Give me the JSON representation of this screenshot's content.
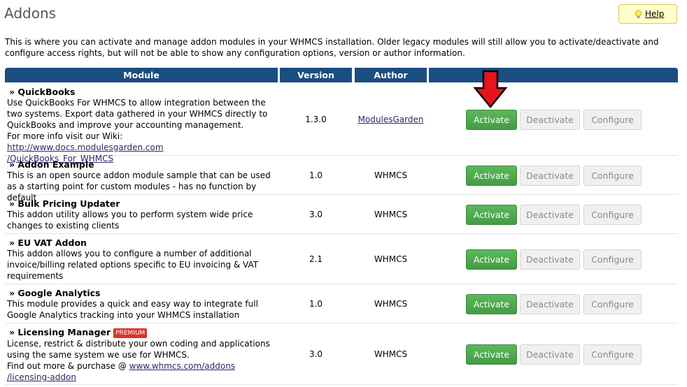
{
  "page": {
    "title": "Addons",
    "help_label": "Help",
    "intro": "This is where you can activate and manage addon modules in your WHMCS installation. Older legacy modules will still allow you to activate/deactivate and configure access rights, but will not be able to show any configuration options, version or author information."
  },
  "table": {
    "headers": [
      "Module",
      "Version",
      "Author",
      ""
    ],
    "rows": [
      {
        "name": "» QuickBooks",
        "desc": "Use QuickBooks For WHMCS to allow integration between the two systems. Export data gathered in your WHMCS directly to QuickBooks and improve your accounting management.",
        "more_prefix": "For more info visit our Wiki: ",
        "link_line1": "http://www.docs.modulesgarden.com",
        "link_line2": "/QuickBooks_For_WHMCS",
        "version": "1.3.0",
        "author": "ModulesGarden"
      },
      {
        "name": "» Addon Example",
        "desc": "This is an open source addon module sample that can be used as a starting point for custom modules - has no function by default",
        "version": "1.0",
        "author": "WHMCS"
      },
      {
        "name": "» Bulk Pricing Updater",
        "desc": "This addon utility allows you to perform system wide price changes to existing clients",
        "version": "3.0",
        "author": "WHMCS"
      },
      {
        "name": "» EU VAT Addon",
        "desc": "This addon allows you to configure a number of additional invoice/billing related options specific to EU invoicing & VAT requirements",
        "version": "2.1",
        "author": "WHMCS"
      },
      {
        "name": "» Google Analytics",
        "desc": "This module provides a quick and easy way to integrate full Google Analytics tracking into your WHMCS installation",
        "version": "1.0",
        "author": "WHMCS"
      },
      {
        "name": "» Licensing Manager",
        "badge": "PREMIUM",
        "desc": "License, restrict & distribute your own coding and applications using the same system we use for WHMCS.",
        "more_prefix": "Find out more & purchase @ ",
        "link_line1": "www.whmcs.com/addons",
        "link_line2": "/licensing-addon",
        "version": "3.0",
        "author": "WHMCS"
      }
    ]
  },
  "buttons": {
    "activate": "Activate",
    "deactivate": "Deactivate",
    "configure": "Configure"
  },
  "colors": {
    "header_bg": "#1a4d80",
    "activate_green": "#4cae4c",
    "premium_red": "#d9352b",
    "arrow_red": "#e8141b"
  },
  "icons": {
    "help": "lightbulb-icon",
    "annotation": "red-down-arrow"
  }
}
